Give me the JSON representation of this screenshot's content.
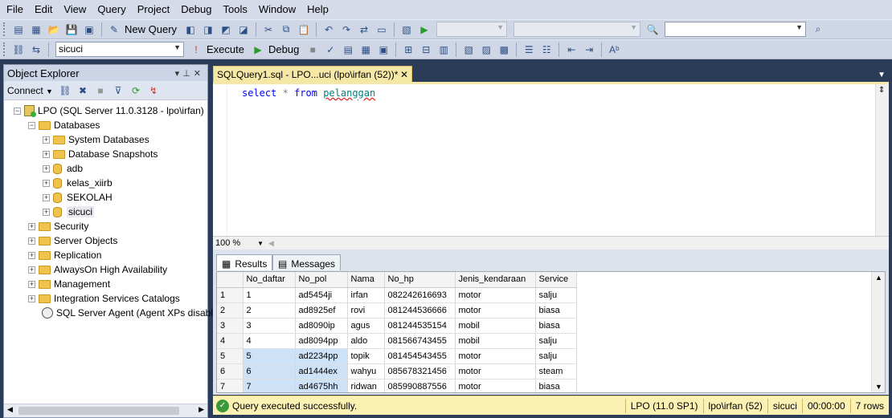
{
  "menu": [
    "File",
    "Edit",
    "View",
    "Query",
    "Project",
    "Debug",
    "Tools",
    "Window",
    "Help"
  ],
  "toolbar1": {
    "new_query_label": "New Query"
  },
  "toolbar2": {
    "database": "sicuci",
    "execute_label": "Execute",
    "debug_label": "Debug"
  },
  "object_explorer": {
    "title": "Object Explorer",
    "connect_label": "Connect",
    "server": "LPO (SQL Server 11.0.3128 - lpo\\irfan)",
    "databases_label": "Databases",
    "database_children": [
      "System Databases",
      "Database Snapshots",
      "adb",
      "kelas_xiirb",
      "SEKOLAH",
      "sicuci"
    ],
    "server_children": [
      "Security",
      "Server Objects",
      "Replication",
      "AlwaysOn High Availability",
      "Management",
      "Integration Services Catalogs"
    ],
    "agent": "SQL Server Agent (Agent XPs disabl"
  },
  "document": {
    "tab_title": "SQLQuery1.sql - LPO...uci (lpo\\irfan (52))*",
    "query": {
      "kw1": "select",
      "star": "*",
      "kw2": "from",
      "table": "pelanggan"
    },
    "zoom": "100 %"
  },
  "results": {
    "tab_results": "Results",
    "tab_messages": "Messages",
    "columns": [
      "No_daftar",
      "No_pol",
      "Nama",
      "No_hp",
      "Jenis_kendaraan",
      "Service"
    ],
    "rows": [
      [
        "1",
        "ad5454ji",
        "irfan",
        "082242616693",
        "motor",
        "salju"
      ],
      [
        "2",
        "ad8925ef",
        "rovi",
        "081244536666",
        "motor",
        "biasa"
      ],
      [
        "3",
        "ad8090ip",
        "agus",
        "081244535154",
        "mobil",
        "biasa"
      ],
      [
        "4",
        "ad8094pp",
        "aldo",
        "081566743455",
        "mobil",
        "salju"
      ],
      [
        "5",
        "ad2234pp",
        "topik",
        "081454543455",
        "motor",
        "salju"
      ],
      [
        "6",
        "ad1444ex",
        "wahyu",
        "085678321456",
        "motor",
        "steam"
      ],
      [
        "7",
        "ad4675hh",
        "ridwan",
        "085990887556",
        "motor",
        "biasa"
      ]
    ],
    "row_numbers": [
      "1",
      "2",
      "3",
      "4",
      "5",
      "6",
      "7"
    ]
  },
  "status": {
    "message": "Query executed successfully.",
    "server": "LPO (11.0 SP1)",
    "user": "lpo\\irfan (52)",
    "database": "sicuci",
    "time": "00:00:00",
    "rows": "7 rows"
  }
}
